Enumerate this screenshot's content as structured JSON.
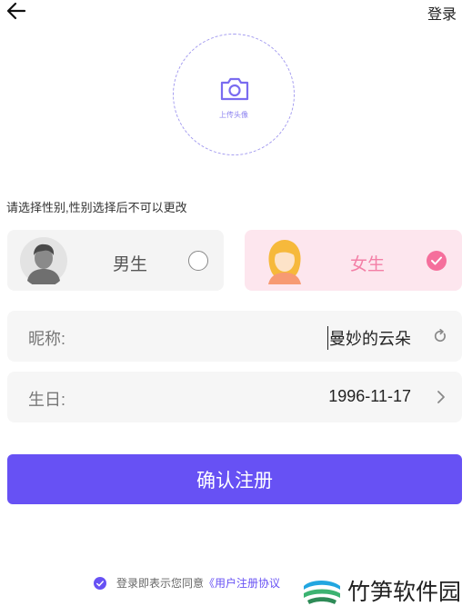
{
  "header": {
    "back_icon": "arrow-left-icon",
    "login_label": "登录"
  },
  "avatar_upload": {
    "icon": "camera-icon",
    "label": "上传头像",
    "accent_color": "#8e84f0"
  },
  "gender": {
    "hint": "请选择性别,性别选择后不可以更改",
    "options": [
      {
        "label": "男生",
        "selected": false,
        "avatar": "male-avatar-icon"
      },
      {
        "label": "女生",
        "selected": true,
        "avatar": "female-avatar-icon"
      }
    ]
  },
  "form": {
    "nickname": {
      "label": "昵称:",
      "value": "曼妙的云朵",
      "icon": "refresh-icon"
    },
    "birthday": {
      "label": "生日:",
      "value": "1996-11-17",
      "icon": "chevron-right-icon"
    }
  },
  "submit": {
    "label": "确认注册",
    "color": "#6751f4"
  },
  "agreement": {
    "checked": true,
    "text": "登录即表示您同意",
    "link": "《用户注册协议"
  },
  "watermark": {
    "text": "竹笋软件园"
  }
}
